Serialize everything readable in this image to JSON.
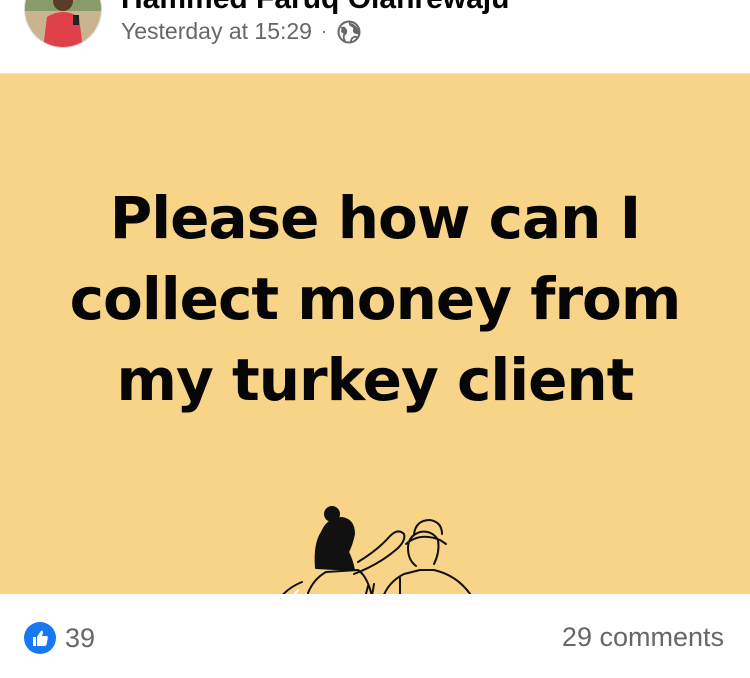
{
  "post": {
    "author_name": "Hammed Faruq Olanrewaju",
    "timestamp": "Yesterday at 15:29",
    "separator": "·",
    "audience_icon": "globe-icon",
    "text": "Please how can I collect money from my turkey client",
    "background_color": "#f7d487"
  },
  "footer": {
    "like_icon": "like-icon",
    "reaction_count": "39",
    "comments_label": "29 comments"
  },
  "colors": {
    "like_blue": "#1877f2",
    "meta_gray": "#65676b"
  }
}
